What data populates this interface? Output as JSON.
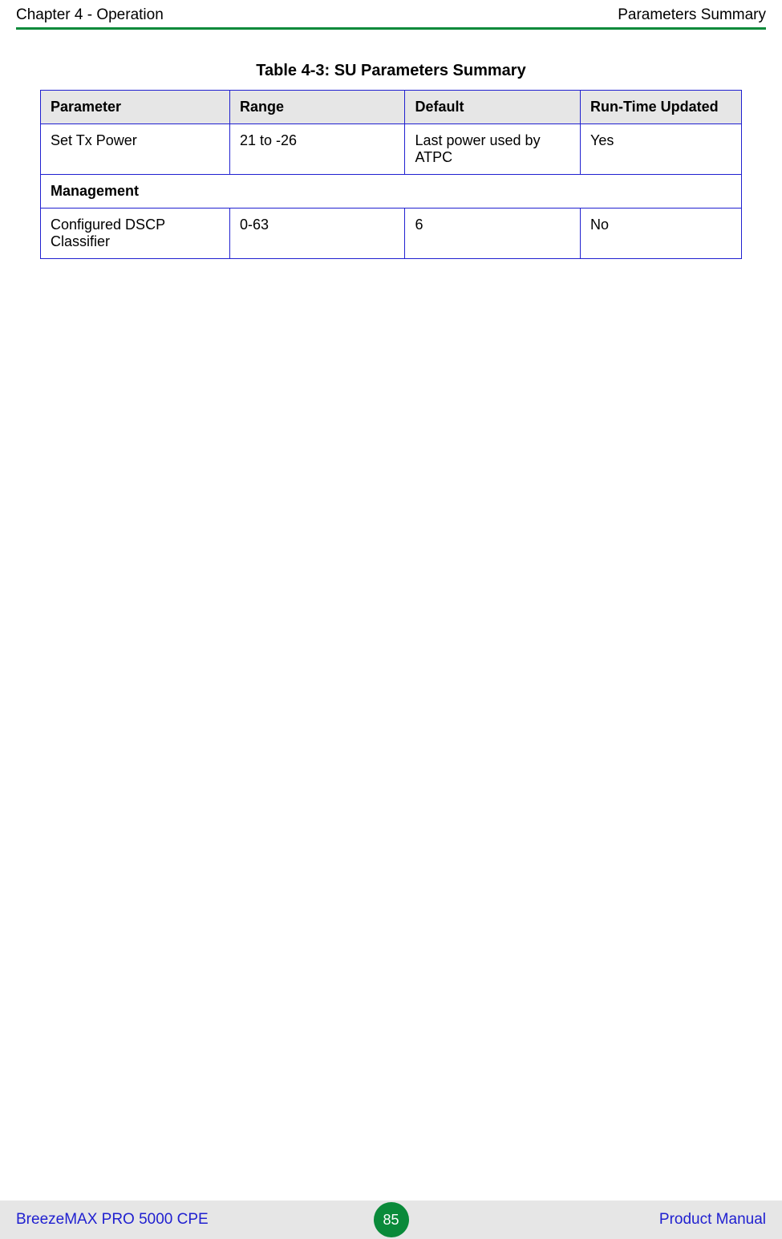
{
  "header": {
    "left": "Chapter 4 - Operation",
    "right": "Parameters Summary"
  },
  "table": {
    "caption": "Table 4-3: SU Parameters Summary",
    "headers": {
      "parameter": "Parameter",
      "range": "Range",
      "default": "Default",
      "runtime": "Run-Time Updated"
    },
    "rows": [
      {
        "type": "data",
        "parameter": "Set Tx Power",
        "range": "21 to -26",
        "default": "Last power used by ATPC",
        "runtime": "Yes"
      },
      {
        "type": "section",
        "label": "Management"
      },
      {
        "type": "data",
        "parameter": "Configured DSCP Classifier",
        "range": "0-63",
        "default": "6",
        "runtime": "No"
      }
    ]
  },
  "footer": {
    "left": "BreezeMAX PRO 5000 CPE",
    "page": "85",
    "right": "Product Manual"
  }
}
